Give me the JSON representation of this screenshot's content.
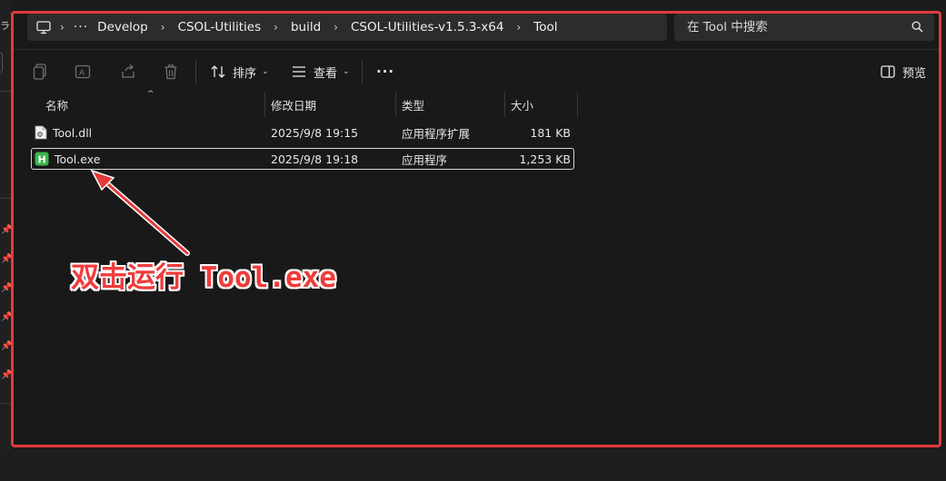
{
  "address_bar": {
    "overflow_label": "···",
    "crumbs": [
      "Develop",
      "CSOL-Utilities",
      "build",
      "CSOL-Utilities-v1.5.3-x64",
      "Tool"
    ]
  },
  "search": {
    "placeholder": "在 Tool 中搜索"
  },
  "toolbar": {
    "sort_label": "排序",
    "view_label": "查看",
    "more_label": "···",
    "preview_label": "预览"
  },
  "columns": {
    "name": "名称",
    "modified": "修改日期",
    "type": "类型",
    "size": "大小"
  },
  "files": [
    {
      "name": "Tool.dll",
      "modified": "2025/9/8 19:15",
      "type": "应用程序扩展",
      "size": "181 KB",
      "icon": "dll-file-icon"
    },
    {
      "name": "Tool.exe",
      "modified": "2025/9/8 19:18",
      "type": "应用程序",
      "size": "1,253 KB",
      "icon": "exe-app-icon"
    }
  ],
  "annotation": {
    "text": "双击运行 Tool.exe"
  },
  "colors": {
    "background": "#191919",
    "annotation_red": "#e23b3b",
    "exe_icon_green": "#3bb54a"
  }
}
